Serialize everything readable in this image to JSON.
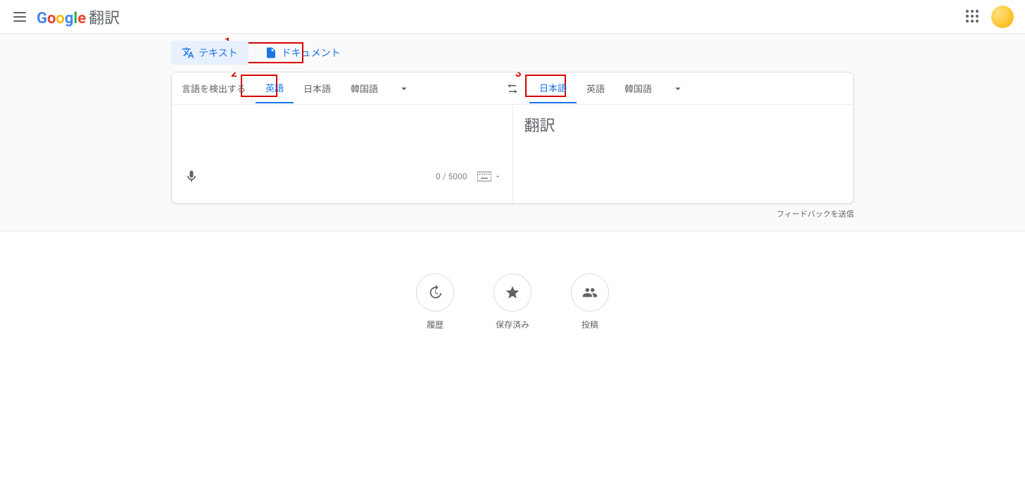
{
  "header": {
    "app_name": "翻訳"
  },
  "modes": {
    "text": "テキスト",
    "document": "ドキュメント"
  },
  "source_tabs": {
    "detect": "言語を検出する",
    "english": "英語",
    "japanese": "日本語",
    "korean": "韓国語"
  },
  "target_tabs": {
    "japanese": "日本語",
    "english": "英語",
    "korean": "韓国語"
  },
  "input": {
    "value": "",
    "char_count": "0 / 5000"
  },
  "output": {
    "placeholder": "翻訳"
  },
  "feedback": "フィードバックを送信",
  "shortcuts": {
    "history": "履歴",
    "saved": "保存済み",
    "contribute": "投稿"
  },
  "annotations": {
    "a1": "1",
    "a2": "2",
    "a3": "3"
  }
}
